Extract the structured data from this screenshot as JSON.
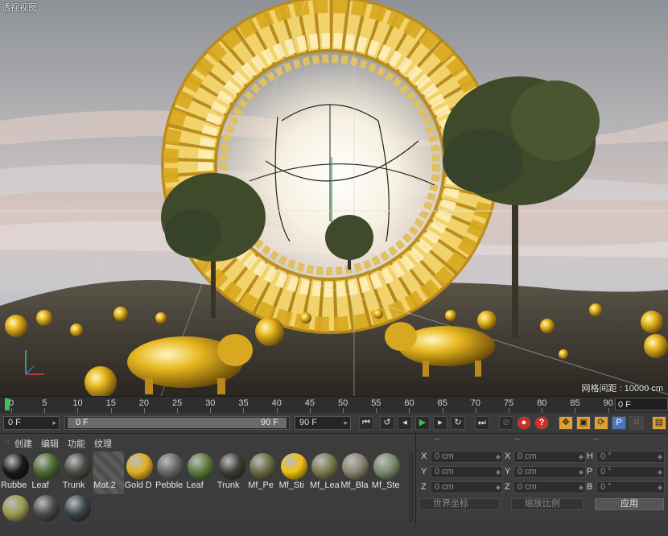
{
  "viewport": {
    "label": "透视视图",
    "grid_spacing": "网格间距 : 10000 cm"
  },
  "timeline": {
    "ticks": [
      "0",
      "5",
      "10",
      "15",
      "20",
      "25",
      "30",
      "35",
      "40",
      "45",
      "50",
      "55",
      "60",
      "65",
      "70",
      "75",
      "80",
      "85",
      "90"
    ],
    "current_frame": "0 F"
  },
  "transport": {
    "start_frame": "0 F",
    "range_start": "0 F",
    "range_end": "90 F",
    "end_frame": "90 F"
  },
  "materials_panel": {
    "menu": [
      "创建",
      "编辑",
      "功能",
      "纹理"
    ],
    "materials": [
      {
        "label": "Rubbe",
        "color": "#1a1a1a"
      },
      {
        "label": "Leaf",
        "color": "#4e6a30"
      },
      {
        "label": "Trunk",
        "color": "#4a4a44"
      },
      {
        "label": "Mat.2",
        "color": ""
      },
      {
        "label": "Gold D",
        "color": "#e0b020"
      },
      {
        "label": "Pebble",
        "color": "#666666"
      },
      {
        "label": "Leaf",
        "color": "#5a7a3a"
      },
      {
        "label": "Trunk",
        "color": "#3e3e38"
      },
      {
        "label": "Mf_Pe",
        "color": "#6a6a42"
      },
      {
        "label": "Mf_Sti",
        "color": "#f0c010"
      },
      {
        "label": "Mf_Lea",
        "color": "#7a7a50"
      },
      {
        "label": "Mf_Bla",
        "color": "#8a8470"
      },
      {
        "label": "Mf_Ste",
        "color": "#7a8a6a"
      },
      {
        "label": "",
        "color": "#9a9a50"
      },
      {
        "label": "",
        "color": "#4a4a4a"
      },
      {
        "label": "",
        "color": "#3a4448"
      }
    ]
  },
  "coordinates": {
    "headers": [
      "--",
      "--",
      "--"
    ],
    "position": [
      {
        "axis": "X",
        "value": "0 cm"
      },
      {
        "axis": "Y",
        "value": "0 cm"
      },
      {
        "axis": "Z",
        "value": "0 cm"
      }
    ],
    "size": [
      {
        "axis": "X",
        "value": "0 cm"
      },
      {
        "axis": "Y",
        "value": "0 cm"
      },
      {
        "axis": "Z",
        "value": "0 cm"
      }
    ],
    "rotation": [
      {
        "axis": "H",
        "value": "0 °"
      },
      {
        "axis": "P",
        "value": "0 °"
      },
      {
        "axis": "B",
        "value": "0 °"
      }
    ],
    "mode_select": "世界坐标",
    "scale_select": "缩放比例",
    "apply_label": "应用"
  },
  "colors": {
    "playhead": "#3fbf4f",
    "gold": "#e0b020",
    "accent_orange": "#e0a030",
    "record_red": "#c8302a"
  }
}
